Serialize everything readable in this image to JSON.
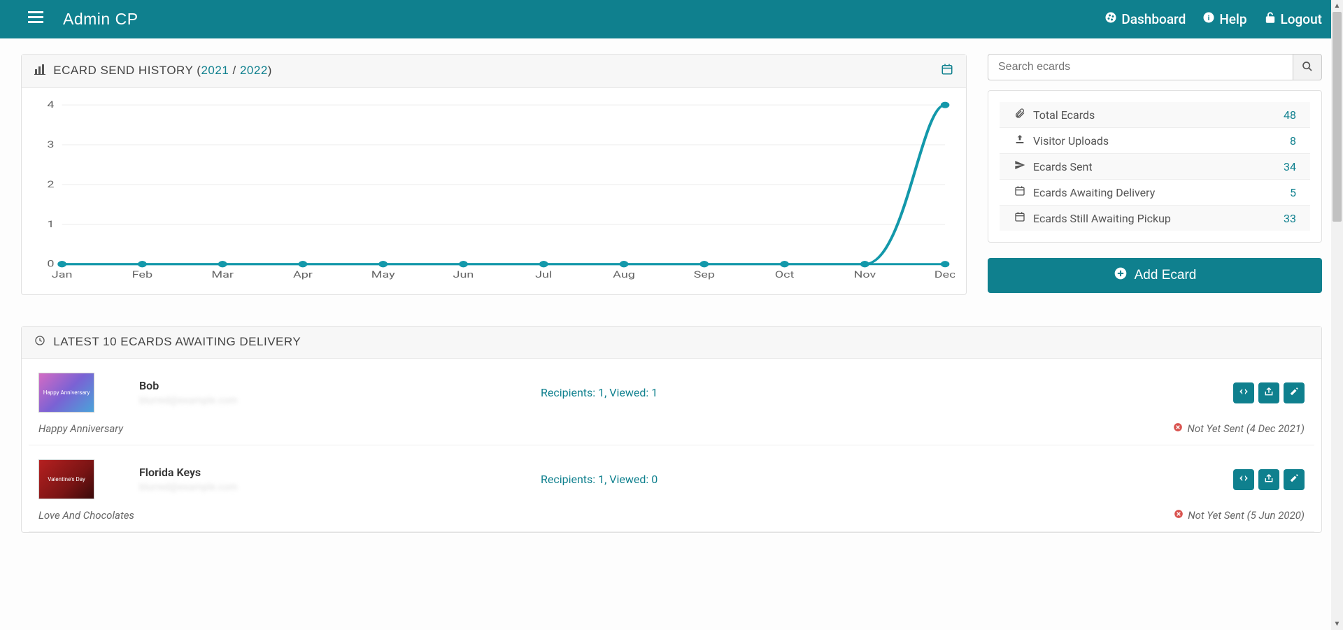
{
  "header": {
    "brand": "Admin CP",
    "nav": {
      "dashboard": "Dashboard",
      "help": "Help",
      "logout": "Logout"
    }
  },
  "chart_panel": {
    "title_prefix": "ECARD SEND HISTORY (",
    "year1": "2021",
    "sep": " / ",
    "year2": "2022",
    "title_suffix": ")"
  },
  "chart_data": {
    "type": "line",
    "categories": [
      "Jan",
      "Feb",
      "Mar",
      "Apr",
      "May",
      "Jun",
      "Jul",
      "Aug",
      "Sep",
      "Oct",
      "Nov",
      "Dec"
    ],
    "series": [
      {
        "name": "2021",
        "values": [
          0,
          0,
          0,
          0,
          0,
          0,
          0,
          0,
          0,
          0,
          0,
          4
        ]
      },
      {
        "name": "2022",
        "values": [
          0,
          0,
          0,
          0,
          0,
          0,
          0,
          0,
          0,
          0,
          0,
          0
        ]
      }
    ],
    "ylim": [
      0,
      4
    ],
    "yticks": [
      0,
      1,
      2,
      3,
      4
    ],
    "xlabel": "",
    "ylabel": "",
    "title": ""
  },
  "search": {
    "placeholder": "Search ecards"
  },
  "stats": [
    {
      "icon": "paperclip",
      "label": "Total Ecards",
      "value": "48"
    },
    {
      "icon": "upload",
      "label": "Visitor Uploads",
      "value": "8"
    },
    {
      "icon": "send",
      "label": "Ecards Sent",
      "value": "34"
    },
    {
      "icon": "calendar",
      "label": "Ecards Awaiting Delivery",
      "value": "5"
    },
    {
      "icon": "calendar",
      "label": "Ecards Still Awaiting Pickup",
      "value": "33"
    }
  ],
  "add_button": "Add Ecard",
  "awaiting_panel": {
    "title": "LATEST 10 ECARDS AWAITING DELIVERY"
  },
  "awaiting": [
    {
      "thumb_class": "anniv",
      "thumb_text": "Happy Anniversary",
      "sender": "Bob",
      "email_placeholder": "blurred@example.com",
      "stats": "Recipients: 1, Viewed: 1",
      "title": "Happy Anniversary",
      "status": "Not Yet Sent (4 Dec 2021)"
    },
    {
      "thumb_class": "val",
      "thumb_text": "Valentine's Day",
      "sender": "Florida Keys",
      "email_placeholder": "blurred@example.com",
      "stats": "Recipients: 1, Viewed: 0",
      "title": "Love And Chocolates",
      "status": "Not Yet Sent (5 Jun 2020)"
    }
  ]
}
